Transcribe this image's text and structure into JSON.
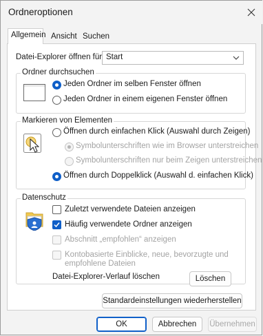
{
  "window": {
    "title": "Ordneroptionen",
    "close_icon": "close-icon"
  },
  "tabs": [
    {
      "label": "Allgemein",
      "active": true
    },
    {
      "label": "Ansicht",
      "active": false
    },
    {
      "label": "Suchen",
      "active": false
    }
  ],
  "explorer_open": {
    "label": "Datei-Explorer öffnen für:",
    "value": "Start"
  },
  "browse_folders": {
    "title": "Ordner durchsuchen",
    "icon": "window-icon",
    "options": [
      {
        "label": "Jeden Ordner im selben Fenster öffnen",
        "selected": true
      },
      {
        "label": "Jeden Ordner in einem eigenen Fenster öffnen",
        "selected": false
      }
    ]
  },
  "click_items": {
    "title": "Markieren von Elementen",
    "icon": "pointer-click-icon",
    "single_click": {
      "label": "Öffnen durch einfachen Klick (Auswahl durch Zeigen)",
      "selected": false
    },
    "underline_options": [
      {
        "label": "Symbolunterschriften wie im Browser unterstreichen",
        "selected": true,
        "disabled": true
      },
      {
        "label": "Symbolunterschriften nur beim Zeigen unterstreichen",
        "selected": false,
        "disabled": true
      }
    ],
    "double_click": {
      "label": "Öffnen durch Doppelklick (Auswahl d. einfachen Klick)",
      "selected": true
    }
  },
  "privacy": {
    "title": "Datenschutz",
    "icon": "privacy-icon",
    "options": [
      {
        "label": "Zuletzt verwendete Dateien anzeigen",
        "checked": false,
        "disabled": false
      },
      {
        "label": "Häufig verwendete Ordner anzeigen",
        "checked": true,
        "disabled": false
      },
      {
        "label": "Abschnitt „empfohlen“ anzeigen",
        "checked": false,
        "disabled": true
      },
      {
        "label_line1": "Kontobasierte Einblicke, neue, bevorzugte und",
        "label_line2": "empfohlene Dateien",
        "checked": false,
        "disabled": true
      }
    ],
    "history_label": "Datei-Explorer-Verlauf löschen",
    "clear_button": "Löschen"
  },
  "restore_defaults": "Standardeinstellungen wiederherstellen",
  "footer": {
    "ok": "OK",
    "cancel": "Abbrechen",
    "apply": "Übernehmen"
  },
  "colors": {
    "accent": "#0f5fc8",
    "panel": "#ffffff",
    "window": "#f3f3f3"
  }
}
